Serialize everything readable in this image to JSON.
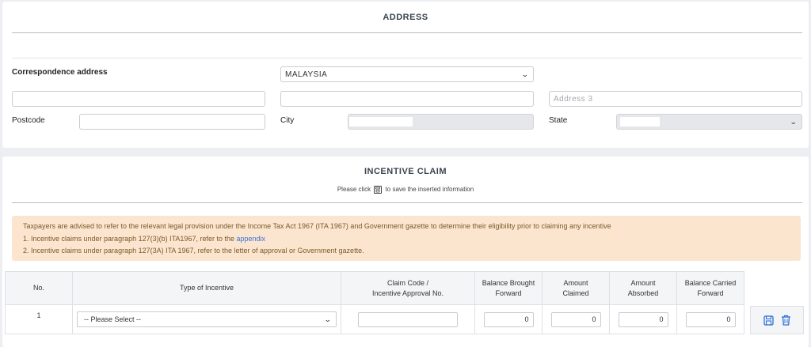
{
  "address": {
    "title": "ADDRESS",
    "correspondence_label": "Correspondence address",
    "country_value": "MALAYSIA",
    "address1_value": "",
    "address2_value": "",
    "address3_placeholder": "Address 3",
    "postcode_label": "Postcode",
    "postcode_value": "",
    "city_label": "City",
    "state_label": "State"
  },
  "incentive": {
    "title": "INCENTIVE CLAIM",
    "hint_before": "Please click",
    "hint_after": "to save the inserted information",
    "notice": {
      "line1": "Taxpayers are advised to refer to the relevant legal provision under the Income Tax Act 1967 (ITA 1967) and Government gazette to determine their eligibility prior to claiming any incentive",
      "line2_prefix": "1. Incentive claims under paragraph 127(3)(b) ITA1967, refer to the",
      "line2_link": "appendix",
      "line3": "2. Incentive claims under paragraph 127(3A) ITA 1967, refer to the letter of approval or Government gazette."
    },
    "table": {
      "col_no": "No.",
      "col_type": "Type of Incentive",
      "col_claim_code_1": "Claim Code /",
      "col_claim_code_2": "Incentive Approval No.",
      "col_bbf_1": "Balance Brought",
      "col_bbf_2": "Forward",
      "col_claimed_1": "Amount",
      "col_claimed_2": "Claimed",
      "col_absorbed_1": "Amount",
      "col_absorbed_2": "Absorbed",
      "col_bcf_1": "Balance Carried",
      "col_bcf_2": "Forward",
      "rows": [
        {
          "no": "1",
          "type_value": "-- Please Select --",
          "claim_code": "",
          "bbf": "0",
          "claimed": "0",
          "absorbed": "0",
          "bcf": "0"
        }
      ]
    },
    "icons": {
      "save": "save-icon",
      "delete": "trash-icon"
    },
    "colors": {
      "notice_bg": "#fbe5cf",
      "link": "#3e73d6",
      "icon_blue": "#2f6fd8"
    }
  }
}
